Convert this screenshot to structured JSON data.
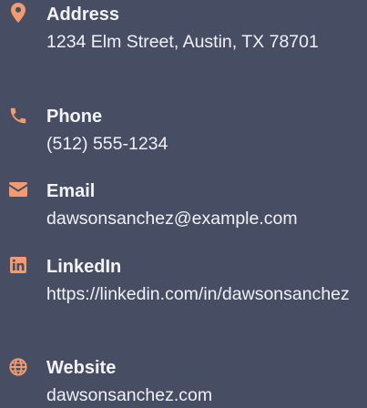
{
  "contact": {
    "address": {
      "icon": "map-pin-icon",
      "label": "Address",
      "value": "1234 Elm Street, Austin, TX 78701"
    },
    "phone": {
      "icon": "phone-icon",
      "label": "Phone",
      "value": "(512) 555-1234"
    },
    "email": {
      "icon": "envelope-icon",
      "label": "Email",
      "value": "dawsonsanchez@example.com"
    },
    "linkedin": {
      "icon": "linkedin-icon",
      "label": "LinkedIn",
      "value": "https://linkedin.com/in/dawsonsanchez"
    },
    "website": {
      "icon": "globe-icon",
      "label": "Website",
      "value": "dawsonsanchez.com"
    }
  },
  "colors": {
    "background": "#474e63",
    "icon_accent": "#f39a6f",
    "text": "#eef2f6"
  }
}
